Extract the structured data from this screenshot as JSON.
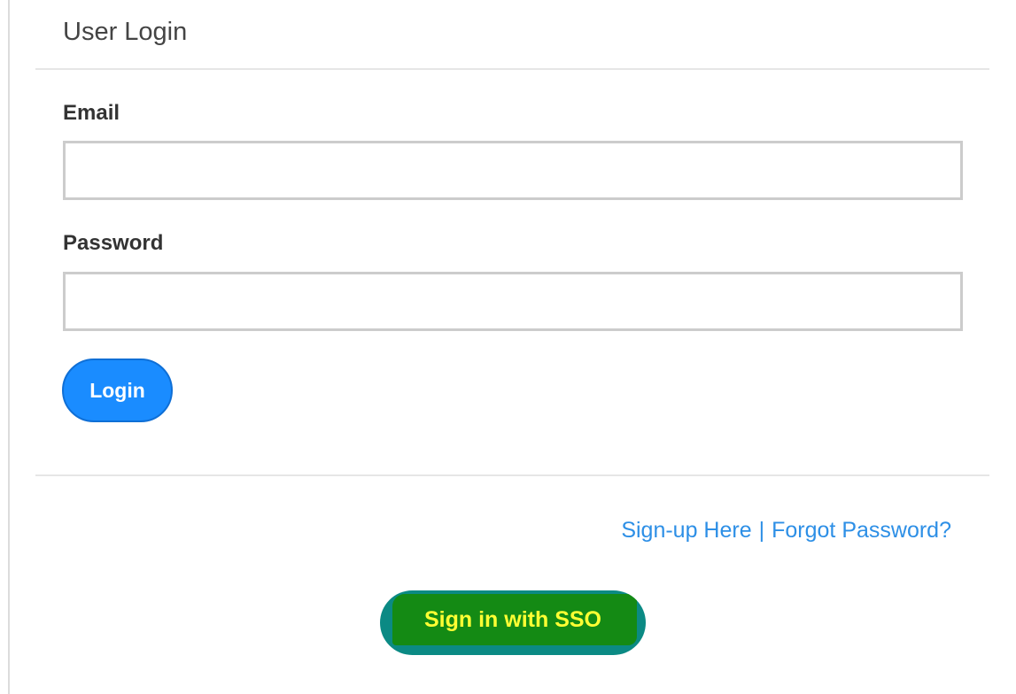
{
  "panel": {
    "title": "User Login"
  },
  "form": {
    "email_label": "Email",
    "email_value": "",
    "password_label": "Password",
    "password_value": "",
    "login_label": "Login"
  },
  "links": {
    "signup": "Sign-up Here",
    "separator": "|",
    "forgot": "Forgot Password?"
  },
  "sso": {
    "label": "Sign in with SSO"
  },
  "colors": {
    "primary_button": "#1a8cff",
    "link": "#2d8fe6",
    "sso_button": "#0b8a84",
    "sso_highlight": "#148a14",
    "sso_text": "#ffff33"
  }
}
